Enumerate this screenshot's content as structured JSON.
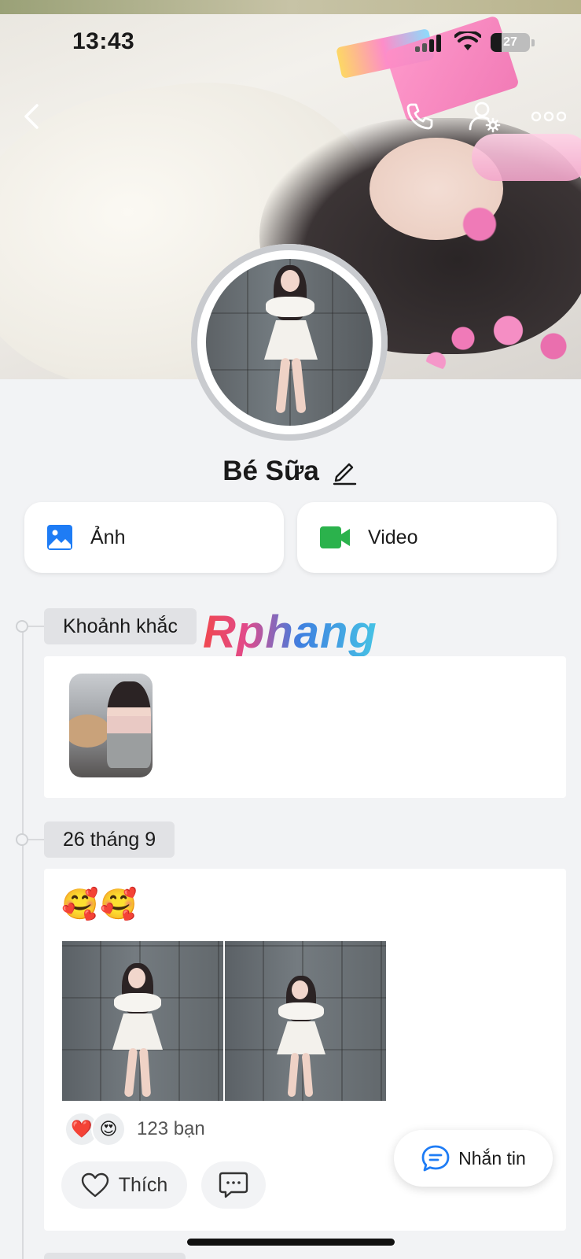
{
  "status_bar": {
    "time": "13:43",
    "battery": "27",
    "battery_level": 0.27
  },
  "profile": {
    "name": "Bé Sữa"
  },
  "albums": [
    {
      "label": "Ảnh",
      "icon": "photo-icon",
      "color": "#1e7cf5"
    },
    {
      "label": "Video",
      "icon": "video-camera-icon",
      "color": "#2bb24c"
    }
  ],
  "watermark": "Rphang",
  "timeline": {
    "moments_title": "Khoảnh khắc",
    "post_date": "26 tháng 9",
    "post": {
      "caption": "🥰🥰",
      "reactions": [
        "❤️",
        "😍"
      ],
      "reaction_count": "123 bạn",
      "like_label": "Thích"
    }
  },
  "message_button": {
    "label": "Nhắn tin"
  },
  "colors": {
    "accent": "#1e7cf5",
    "background": "#f2f3f5",
    "video_green": "#2bb24c",
    "like_red": "#e8263a"
  }
}
